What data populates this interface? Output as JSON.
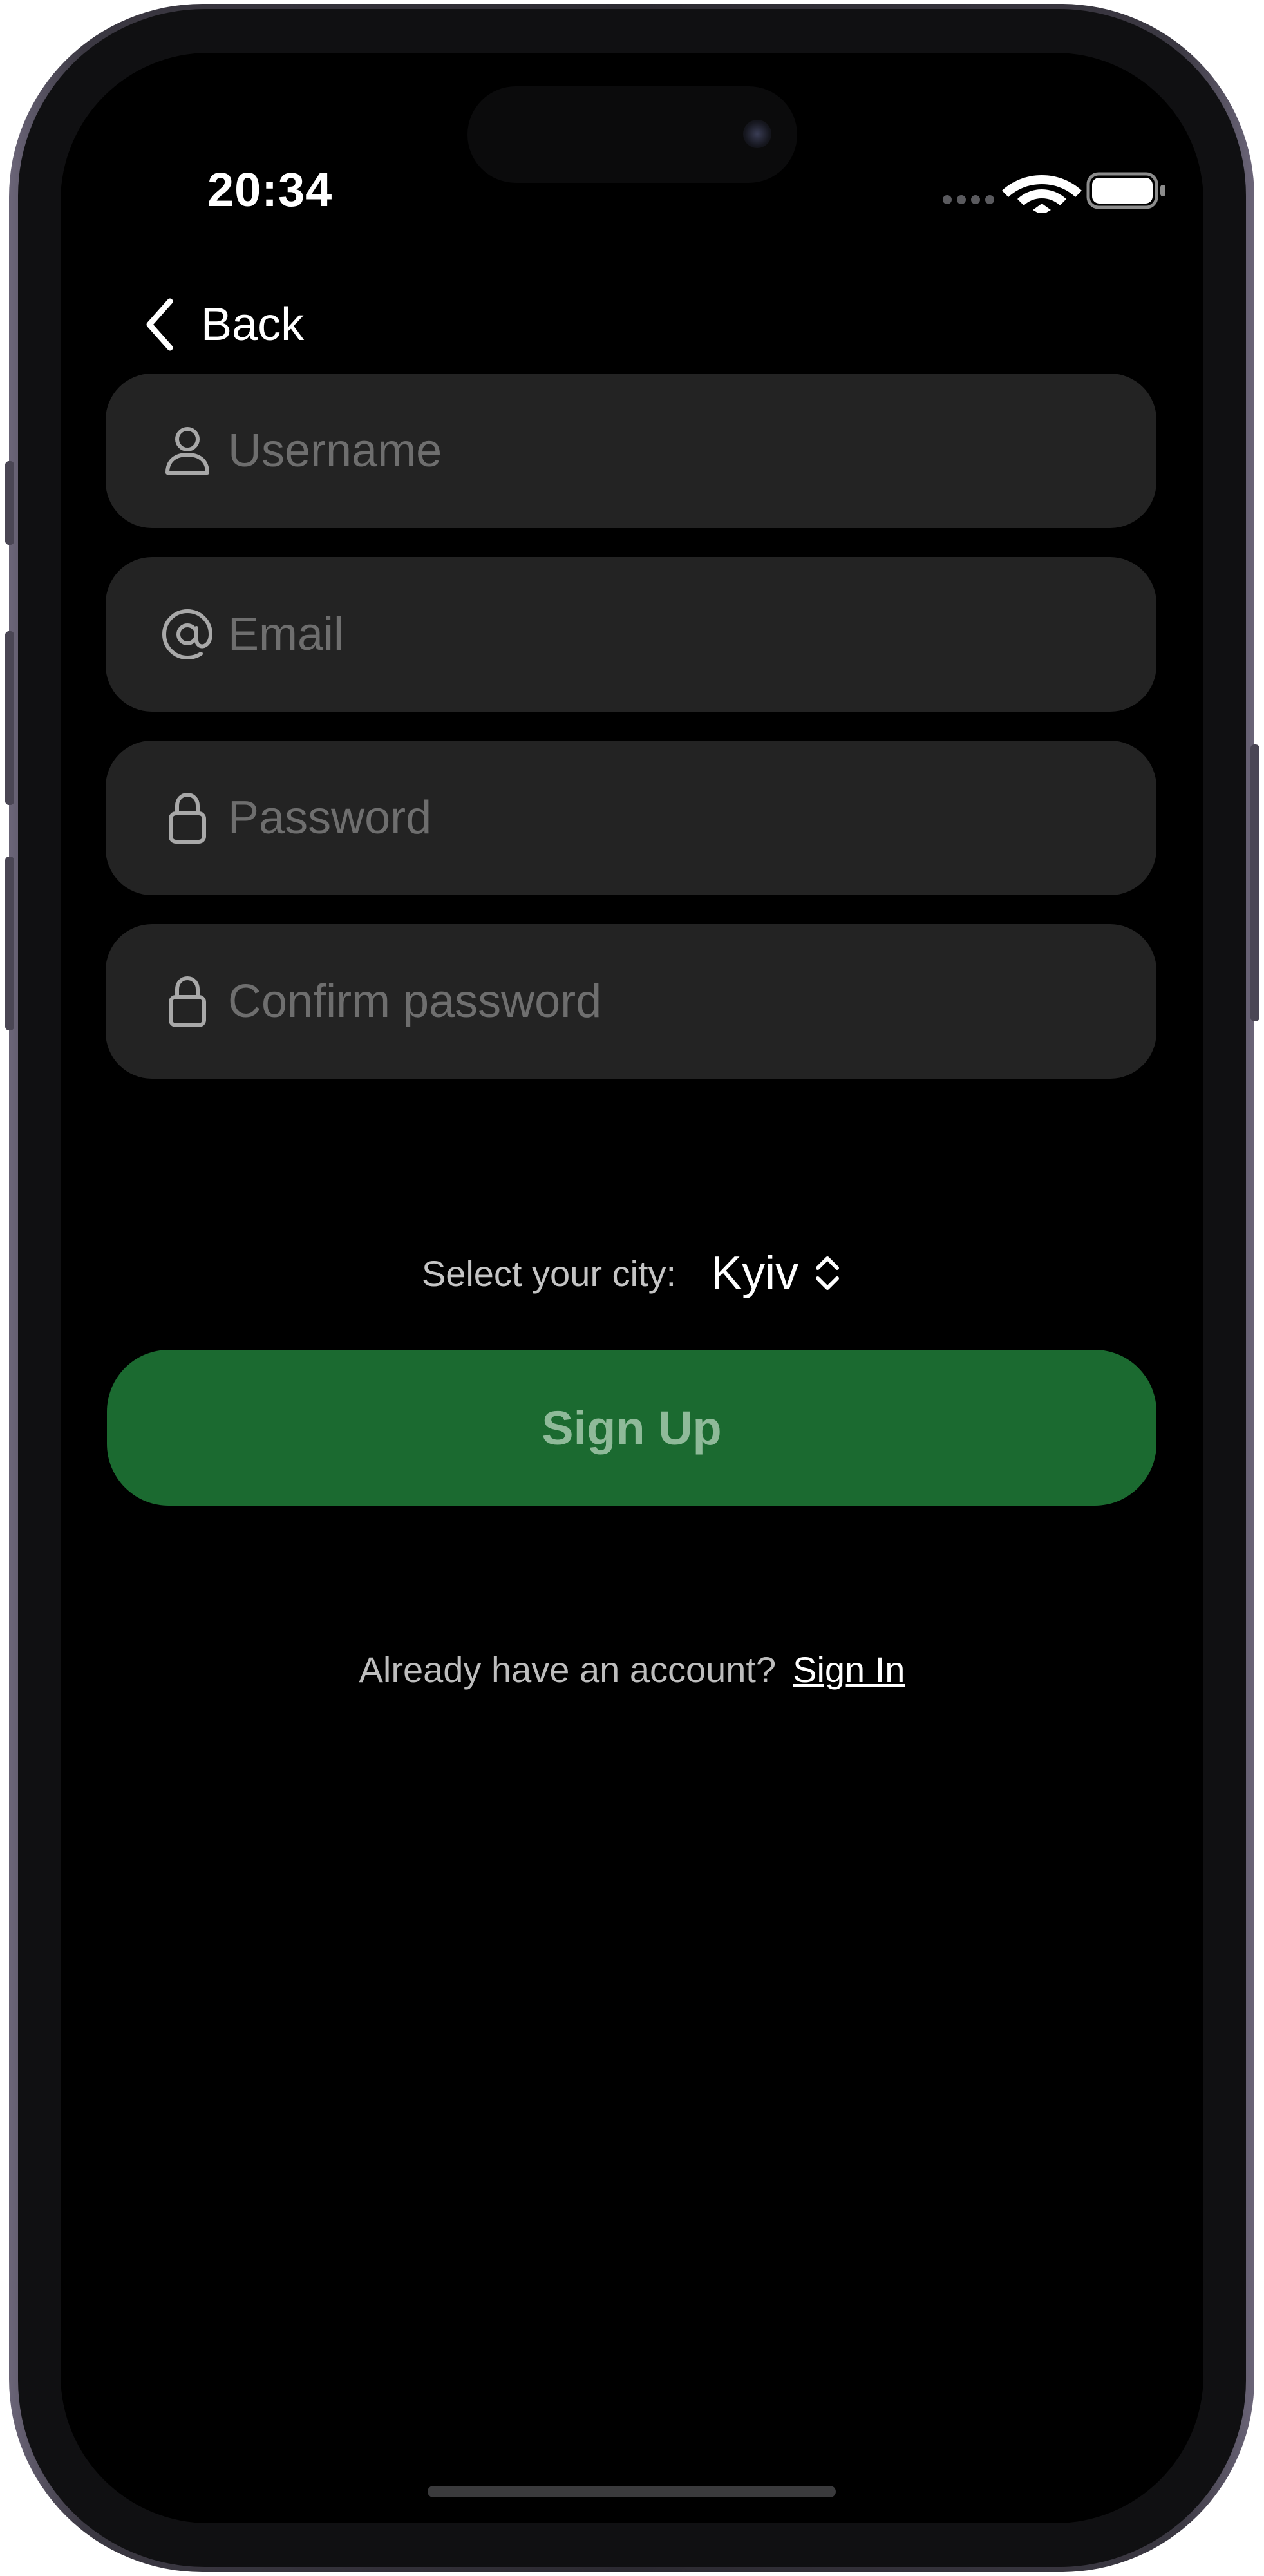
{
  "status_bar": {
    "time": "20:34",
    "cellular_icon": "cellular-dots-icon",
    "wifi_icon": "wifi-icon",
    "battery_icon": "battery-icon"
  },
  "nav": {
    "back_label": "Back",
    "back_icon": "chevron-left-icon"
  },
  "form": {
    "username": {
      "placeholder": "Username",
      "value": "",
      "icon": "person-icon"
    },
    "email": {
      "placeholder": "Email",
      "value": "",
      "icon": "at-sign-icon"
    },
    "password": {
      "placeholder": "Password",
      "value": "",
      "icon": "lock-icon"
    },
    "confirm_password": {
      "placeholder": "Confirm password",
      "value": "",
      "icon": "lock-icon"
    }
  },
  "city": {
    "label": "Select your city:",
    "selected": "Kyiv",
    "icon": "chevron-up-down-icon"
  },
  "actions": {
    "sign_up_label": "Sign Up"
  },
  "footer": {
    "prompt": "Already have an account?",
    "sign_in_label": "Sign In"
  },
  "colors": {
    "background": "#000000",
    "field_background": "#232323",
    "primary_button": "#1b6a30",
    "primary_button_text": "#8fba99",
    "placeholder_text": "#6e6e6e"
  }
}
